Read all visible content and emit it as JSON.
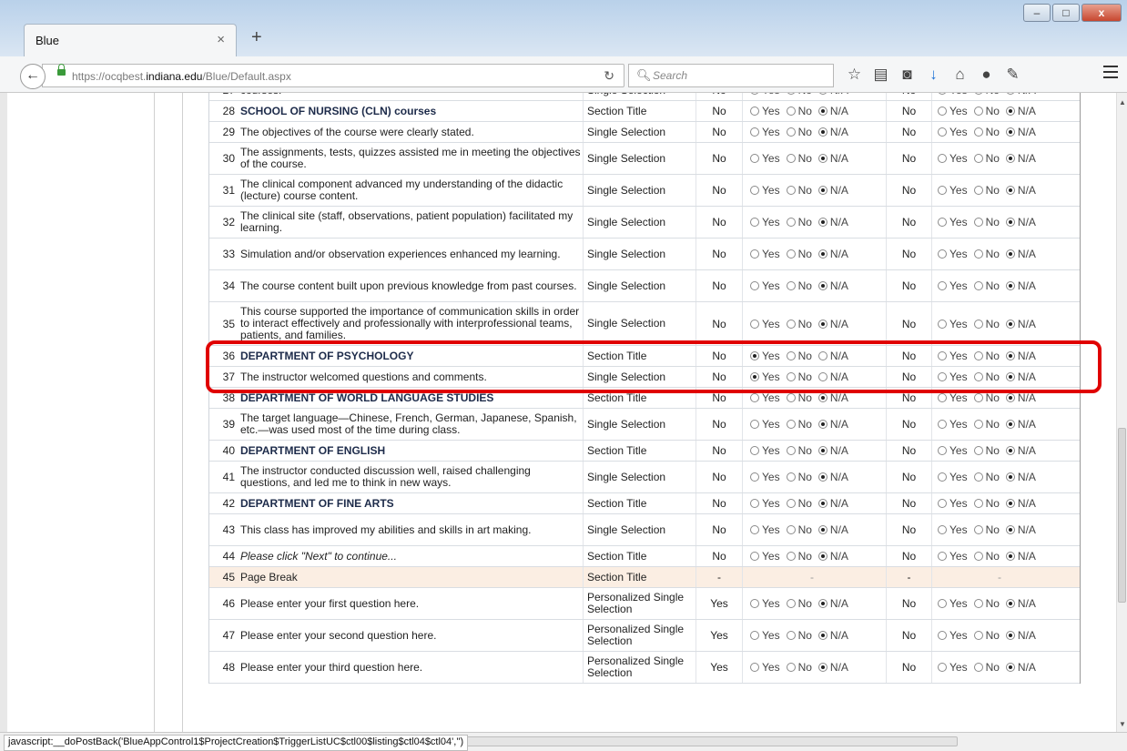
{
  "browser": {
    "tab_title": "Blue",
    "tab_close": "×",
    "new_tab": "+",
    "url_prefix": "https://ocqbest.",
    "url_domain": "indiana.edu",
    "url_path": "/Blue/Default.aspx",
    "search_placeholder": "Search",
    "status_text": "javascript:__doPostBack('BlueAppControl1$ProjectCreation$TriggerListUC$ctl00$listing$ctl04$ctl04','')"
  },
  "options": {
    "yes": "Yes",
    "no": "No",
    "na": "N/A"
  },
  "rows": [
    {
      "num": "27",
      "text": "courses.",
      "type": "Single Selection",
      "req1": "No",
      "sel1": "na",
      "req2": "No",
      "sel2": "na",
      "style": "normal"
    },
    {
      "num": "28",
      "text": "SCHOOL OF NURSING (CLN) courses",
      "type": "Section Title",
      "req1": "No",
      "sel1": "na",
      "req2": "No",
      "sel2": "na",
      "style": "bold"
    },
    {
      "num": "29",
      "text": "The objectives of the course were clearly stated.",
      "type": "Single Selection",
      "req1": "No",
      "sel1": "na",
      "req2": "No",
      "sel2": "na",
      "style": "normal"
    },
    {
      "num": "30",
      "text": "The assignments, tests, quizzes assisted me in meeting the objectives of the course.",
      "type": "Single Selection",
      "req1": "No",
      "sel1": "na",
      "req2": "No",
      "sel2": "na",
      "style": "normal"
    },
    {
      "num": "31",
      "text": "The clinical component advanced my understanding of the didactic (lecture) course content.",
      "type": "Single Selection",
      "req1": "No",
      "sel1": "na",
      "req2": "No",
      "sel2": "na",
      "style": "normal"
    },
    {
      "num": "32",
      "text": "The clinical site (staff, observations, patient population) facilitated my learning.",
      "type": "Single Selection",
      "req1": "No",
      "sel1": "na",
      "req2": "No",
      "sel2": "na",
      "style": "normal"
    },
    {
      "num": "33",
      "text": "Simulation and/or observation experiences enhanced my learning.",
      "type": "Single Selection",
      "req1": "No",
      "sel1": "na",
      "req2": "No",
      "sel2": "na",
      "style": "normal"
    },
    {
      "num": "34",
      "text": "The course content built upon previous knowledge from past courses.",
      "type": "Single Selection",
      "req1": "No",
      "sel1": "na",
      "req2": "No",
      "sel2": "na",
      "style": "normal"
    },
    {
      "num": "35",
      "text": "This course supported the importance of communication skills in order to interact effectively and professionally with interprofessional teams, patients, and families.",
      "type": "Single Selection",
      "req1": "No",
      "sel1": "na",
      "req2": "No",
      "sel2": "na",
      "style": "normal"
    },
    {
      "num": "36",
      "text": "DEPARTMENT OF PSYCHOLOGY",
      "type": "Section Title",
      "req1": "No",
      "sel1": "yes",
      "req2": "No",
      "sel2": "na",
      "style": "bold"
    },
    {
      "num": "37",
      "text": "The instructor welcomed questions and comments.",
      "type": "Single Selection",
      "req1": "No",
      "sel1": "yes",
      "req2": "No",
      "sel2": "na",
      "style": "normal"
    },
    {
      "num": "38",
      "text": "DEPARTMENT OF WORLD LANGUAGE STUDIES",
      "type": "Section Title",
      "req1": "No",
      "sel1": "na",
      "req2": "No",
      "sel2": "na",
      "style": "bold"
    },
    {
      "num": "39",
      "text": "The target language—Chinese, French, German, Japanese, Spanish, etc.—was used most of the time during class.",
      "type": "Single Selection",
      "req1": "No",
      "sel1": "na",
      "req2": "No",
      "sel2": "na",
      "style": "normal"
    },
    {
      "num": "40",
      "text": "DEPARTMENT OF ENGLISH",
      "type": "Section Title",
      "req1": "No",
      "sel1": "na",
      "req2": "No",
      "sel2": "na",
      "style": "bold"
    },
    {
      "num": "41",
      "text": "The instructor conducted discussion well, raised challenging questions, and led me to think in new ways.",
      "type": "Single Selection",
      "req1": "No",
      "sel1": "na",
      "req2": "No",
      "sel2": "na",
      "style": "normal"
    },
    {
      "num": "42",
      "text": "DEPARTMENT OF FINE ARTS",
      "type": "Section Title",
      "req1": "No",
      "sel1": "na",
      "req2": "No",
      "sel2": "na",
      "style": "bold"
    },
    {
      "num": "43",
      "text": "This class has improved my abilities and skills in art making.",
      "type": "Single Selection",
      "req1": "No",
      "sel1": "na",
      "req2": "No",
      "sel2": "na",
      "style": "normal"
    },
    {
      "num": "44",
      "text": "Please click \"Next\" to continue...",
      "type": "Section Title",
      "req1": "No",
      "sel1": "na",
      "req2": "No",
      "sel2": "na",
      "style": "italic"
    },
    {
      "num": "45",
      "text": "Page Break",
      "type": "Section Title",
      "req1": "-",
      "sel1": "-",
      "req2": "-",
      "sel2": "-",
      "style": "break"
    },
    {
      "num": "46",
      "text": "Please enter your first question here.",
      "type": "Personalized Single Selection",
      "req1": "Yes",
      "sel1": "na",
      "req2": "No",
      "sel2": "na",
      "style": "normal"
    },
    {
      "num": "47",
      "text": "Please enter your second question here.",
      "type": "Personalized Single Selection",
      "req1": "Yes",
      "sel1": "na",
      "req2": "No",
      "sel2": "na",
      "style": "normal"
    },
    {
      "num": "48",
      "text": "Please enter your third question here.",
      "type": "Personalized Single Selection",
      "req1": "Yes",
      "sel1": "na",
      "req2": "No",
      "sel2": "na",
      "style": "normal"
    }
  ],
  "icons": [
    "back-icon",
    "lock-icon",
    "reload-icon",
    "search-icon",
    "bookmark-star-icon",
    "reading-list-icon",
    "pocket-icon",
    "download-icon",
    "home-icon",
    "chat-icon",
    "wrench-icon",
    "menu-icon"
  ],
  "colors": {
    "highlight": "#e00000",
    "section_title": "#1d2b4a",
    "page_break_bg": "#fbeee3"
  }
}
